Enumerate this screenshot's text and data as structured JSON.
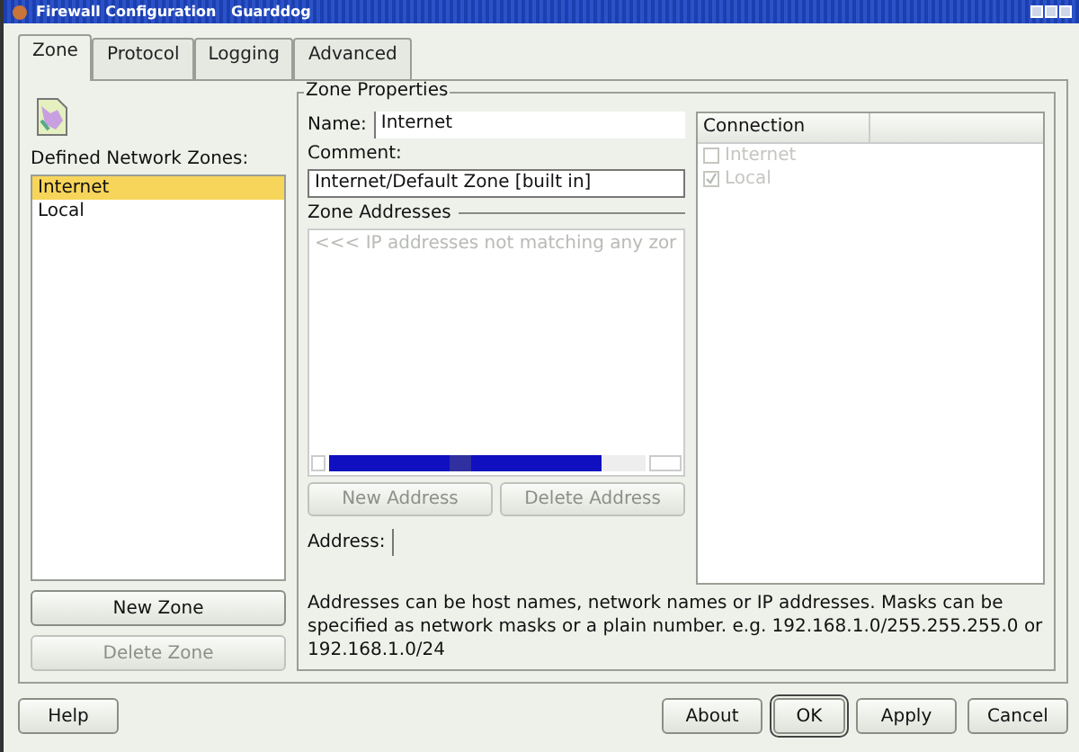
{
  "window": {
    "title": "Firewall Configuration   Guarddog"
  },
  "tabs": [
    {
      "label": "Zone",
      "selected": true
    },
    {
      "label": "Protocol",
      "selected": false
    },
    {
      "label": "Logging",
      "selected": false
    },
    {
      "label": "Advanced",
      "selected": false
    }
  ],
  "zones": {
    "label": "Defined Network Zones:",
    "items": [
      {
        "label": "Internet",
        "selected": true
      },
      {
        "label": "Local",
        "selected": false
      }
    ]
  },
  "zone_buttons": [
    {
      "label": "New Zone",
      "disabled": false
    },
    {
      "label": "Delete Zone",
      "disabled": true
    }
  ],
  "zone_properties": {
    "title": "Zone Properties",
    "name_label": "Name:",
    "name_value": "Internet",
    "comment_label": "Comment:",
    "comment_value": "Internet/Default Zone [built in]",
    "addresses_title": "Zone Addresses",
    "address_items": [
      "<<< IP addresses not matching any zor"
    ],
    "address_buttons": [
      {
        "label": "New Address",
        "disabled": true
      },
      {
        "label": "Delete Address",
        "disabled": true
      }
    ],
    "address_label": "Address:",
    "connection": {
      "header": "Connection",
      "items": [
        {
          "label": "Internet",
          "checked": false,
          "disabled": true
        },
        {
          "label": "Local",
          "checked": true,
          "disabled": true
        }
      ]
    },
    "help_text": "Addresses can be host names, network names or IP addresses. Masks can be specified as network masks or a plain number. e.g. 192.168.1.0/255.255.255.0 or 192.168.1.0/24"
  },
  "footer_buttons": [
    {
      "label": "Help",
      "default": false
    },
    {
      "label": "About",
      "default": false
    },
    {
      "label": "OK",
      "default": true
    },
    {
      "label": "Apply",
      "default": false
    },
    {
      "label": "Cancel",
      "default": false
    }
  ]
}
